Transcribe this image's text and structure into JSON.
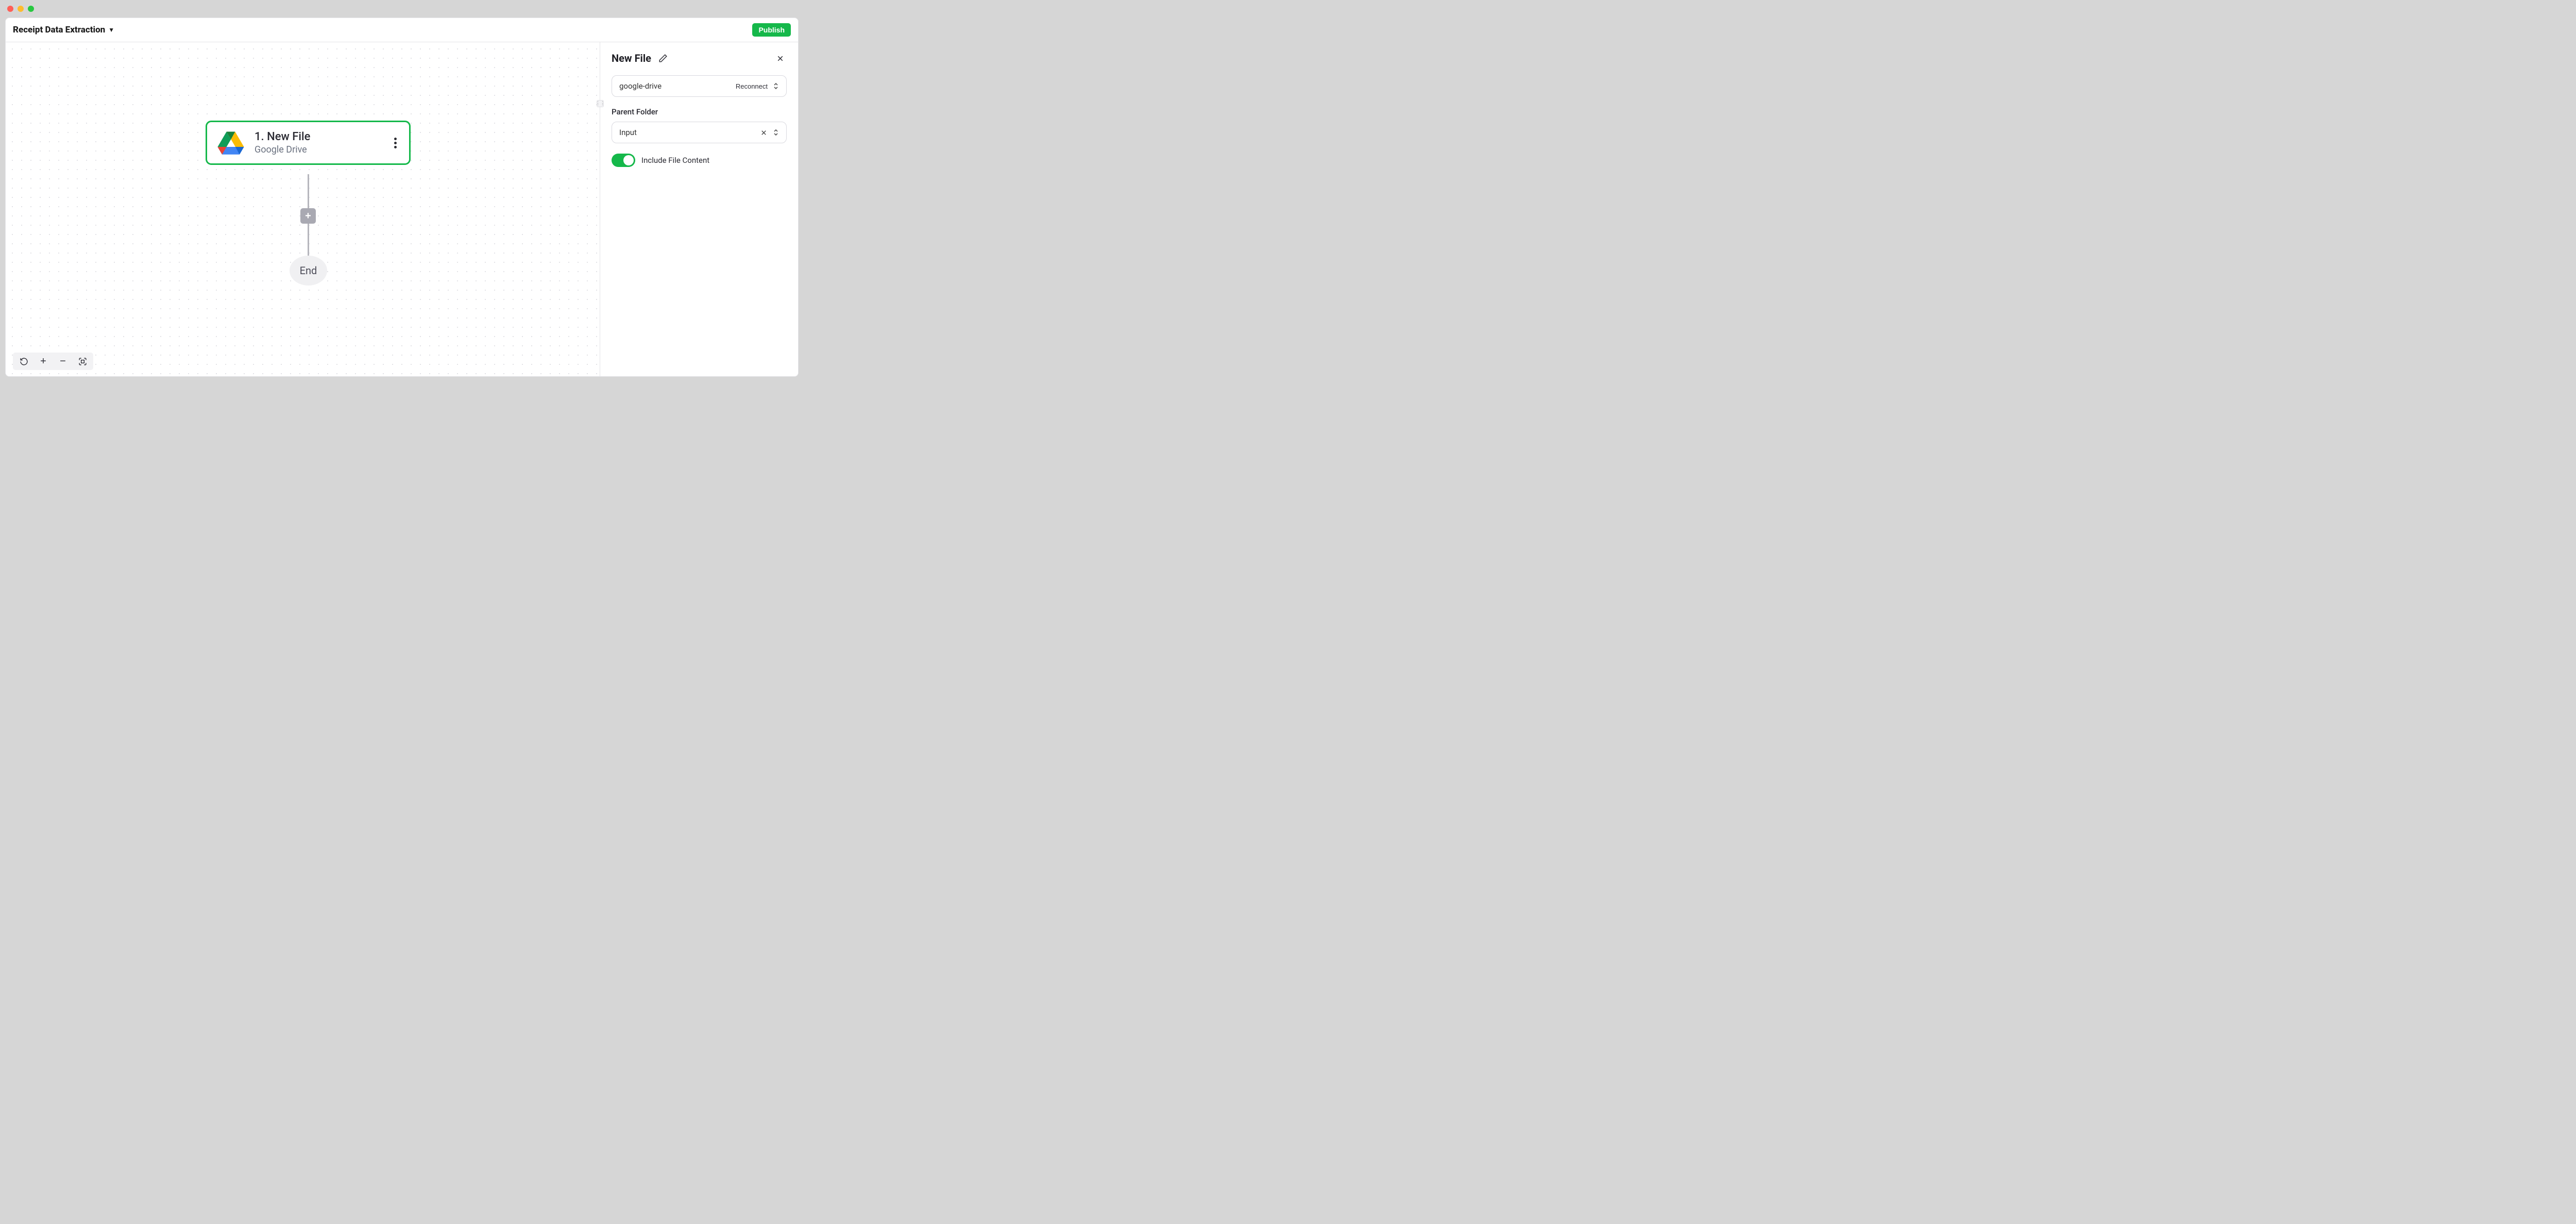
{
  "header": {
    "flow_name": "Receipt Data Extraction",
    "publish_label": "Publish"
  },
  "canvas": {
    "node": {
      "title": "1. New File",
      "subtitle": "Google Drive"
    },
    "end_label": "End"
  },
  "panel": {
    "title": "New File",
    "connection": {
      "value": "google-drive",
      "reconnect_label": "Reconnect"
    },
    "parent_folder": {
      "label": "Parent Folder",
      "value": "Input"
    },
    "include_file_content_label": "Include File Content"
  }
}
